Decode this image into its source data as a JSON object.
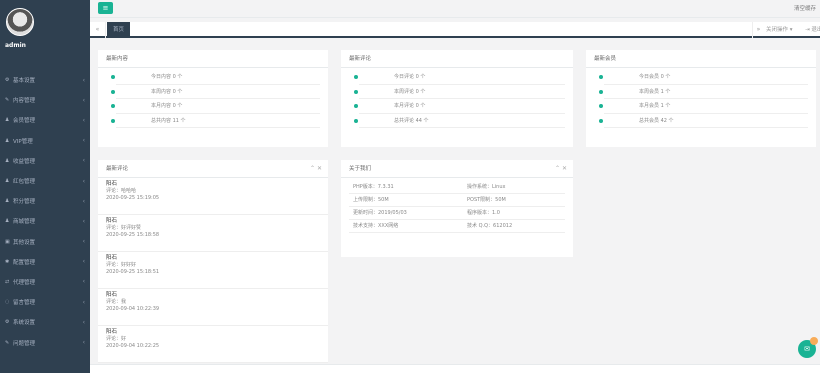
{
  "sidebar": {
    "user_name": "admin",
    "items": [
      {
        "label": "基本设置",
        "icon": "gear-icon",
        "glyph": "⚙"
      },
      {
        "label": "内容管理",
        "icon": "edit-icon",
        "glyph": "✎"
      },
      {
        "label": "会员管理",
        "icon": "user-icon",
        "glyph": "♟"
      },
      {
        "label": "VIP管理",
        "icon": "user-icon",
        "glyph": "♟"
      },
      {
        "label": "收益管理",
        "icon": "user-icon",
        "glyph": "♟"
      },
      {
        "label": "红包管理",
        "icon": "user-icon",
        "glyph": "♟"
      },
      {
        "label": "积分管理",
        "icon": "user-icon",
        "glyph": "♟"
      },
      {
        "label": "商城管理",
        "icon": "user-icon",
        "glyph": "♟"
      },
      {
        "label": "其他设置",
        "icon": "folder-icon",
        "glyph": "▣"
      },
      {
        "label": "配置管理",
        "icon": "star-icon",
        "glyph": "✱"
      },
      {
        "label": "代理管理",
        "icon": "exchange-icon",
        "glyph": "⇄"
      },
      {
        "label": "留言管理",
        "icon": "comment-icon",
        "glyph": "◌"
      },
      {
        "label": "系统设置",
        "icon": "gears-icon",
        "glyph": "⚙"
      },
      {
        "label": "问题管理",
        "icon": "edit-icon",
        "glyph": "✎"
      }
    ]
  },
  "topbar": {
    "menu_glyph": "≡",
    "right_text": "清空缓存"
  },
  "tabs": {
    "left_glyph": "«",
    "home": "首页",
    "right_glyph": "»",
    "close_op": "关闭操作",
    "exit": "⇥ 退出"
  },
  "panels": {
    "content": {
      "title": "最新内容",
      "rows": [
        "今日内容 0 个",
        "本周内容 0 个",
        "本月内容 0 个",
        "总共内容 11 个"
      ]
    },
    "comments_stat": {
      "title": "最新评论",
      "rows": [
        "今日评论 0 个",
        "本周评论 0 个",
        "本月评论 0 个",
        "总共评论 44 个"
      ]
    },
    "members": {
      "title": "最新会员",
      "rows": [
        "今日会员 0 个",
        "本周会员 1 个",
        "本月会员 1 个",
        "总共会员 42 个"
      ]
    },
    "recent_comments": {
      "title": "最新评论",
      "tools": "⌃ ✕",
      "items": [
        {
          "name": "阳石",
          "body": "评论：哈哈哈",
          "date": "2020-09-25 15:19:05"
        },
        {
          "name": "阳石",
          "body": "评论：好评好赞",
          "date": "2020-09-25 15:18:58"
        },
        {
          "name": "阳石",
          "body": "评论：好好好",
          "date": "2020-09-25 15:18:51"
        },
        {
          "name": "阳石",
          "body": "评论：我",
          "date": "2020-09-04 10:22:39"
        },
        {
          "name": "阳石",
          "body": "评论：好",
          "date": "2020-09-04 10:22:25"
        }
      ]
    },
    "about": {
      "title": "关于我们",
      "tools": "⌃ ✕",
      "rows": [
        [
          "PHP版本：7.3.31",
          "操作系统：Linux"
        ],
        [
          "上传限制：50M",
          "POST限制：50M"
        ],
        [
          "更新时间：2019/05/03",
          "程序版本：1.0"
        ],
        [
          "技术支持：XXX网络",
          "技术 Q.Q：612012"
        ]
      ]
    }
  },
  "chat": {
    "glyph": "✉"
  },
  "colors": {
    "accent": "#1ab394",
    "sidebar": "#2f4050",
    "badge": "#f8ac59"
  }
}
